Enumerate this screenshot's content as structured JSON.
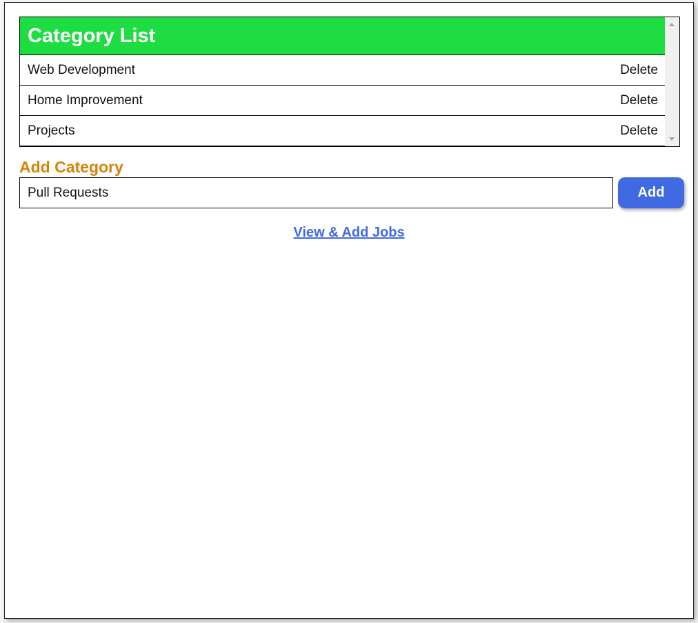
{
  "category_list": {
    "title": "Category List",
    "items": [
      {
        "name": "Web Development",
        "action": "Delete"
      },
      {
        "name": "Home Improvement",
        "action": "Delete"
      },
      {
        "name": "Projects",
        "action": "Delete"
      }
    ]
  },
  "add_category": {
    "title": "Add Category",
    "input_value": "Pull Requests",
    "button_label": "Add"
  },
  "link": {
    "label": "View & Add Jobs"
  },
  "colors": {
    "header": "#1edd42",
    "accent": "#4169e1",
    "add_title": "#d4860b"
  }
}
